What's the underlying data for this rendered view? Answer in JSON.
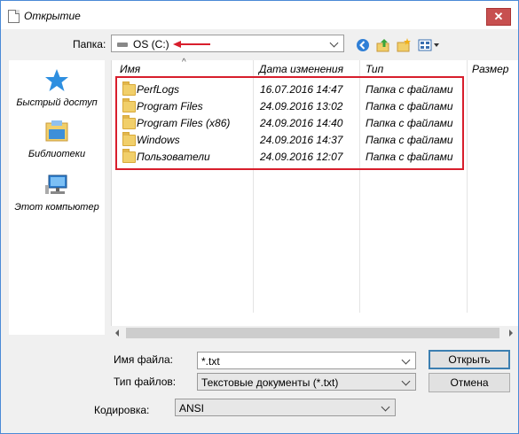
{
  "window": {
    "title": "Открытие",
    "close_glyph": "✕"
  },
  "toolbar": {
    "folder_label": "Папка:",
    "folder_value": "OS (C:)",
    "icons": [
      "back-icon",
      "up-folder-icon",
      "new-folder-icon",
      "view-menu-icon"
    ]
  },
  "sidebar": {
    "items": [
      {
        "label": "Быстрый доступ",
        "icon": "star-icon"
      },
      {
        "label": "Библиотеки",
        "icon": "libraries-icon"
      },
      {
        "label": "Этот компьютер",
        "icon": "computer-icon"
      }
    ]
  },
  "filelist": {
    "columns": [
      "Имя",
      "Дата изменения",
      "Тип",
      "Размер"
    ],
    "sort_caret": "^",
    "rows": [
      {
        "name": "PerfLogs",
        "date": "16.07.2016 14:47",
        "type": "Папка с файлами"
      },
      {
        "name": "Program Files",
        "date": "24.09.2016 13:02",
        "type": "Папка с файлами"
      },
      {
        "name": "Program Files (x86)",
        "date": "24.09.2016 14:40",
        "type": "Папка с файлами"
      },
      {
        "name": "Windows",
        "date": "24.09.2016 14:37",
        "type": "Папка с файлами"
      },
      {
        "name": "Пользователи",
        "date": "24.09.2016 12:07",
        "type": "Папка с файлами"
      }
    ]
  },
  "form": {
    "filename_label": "Имя файла:",
    "filename_value": "*.txt",
    "filetype_label": "Тип файлов:",
    "filetype_value": "Текстовые документы (*.txt)",
    "encoding_label": "Кодировка:",
    "encoding_value": "ANSI"
  },
  "buttons": {
    "open": "Открыть",
    "cancel": "Отмена"
  },
  "colors": {
    "highlight": "#d81e2c",
    "accent": "#3c7fb1",
    "folder": "#f1cf6a"
  }
}
